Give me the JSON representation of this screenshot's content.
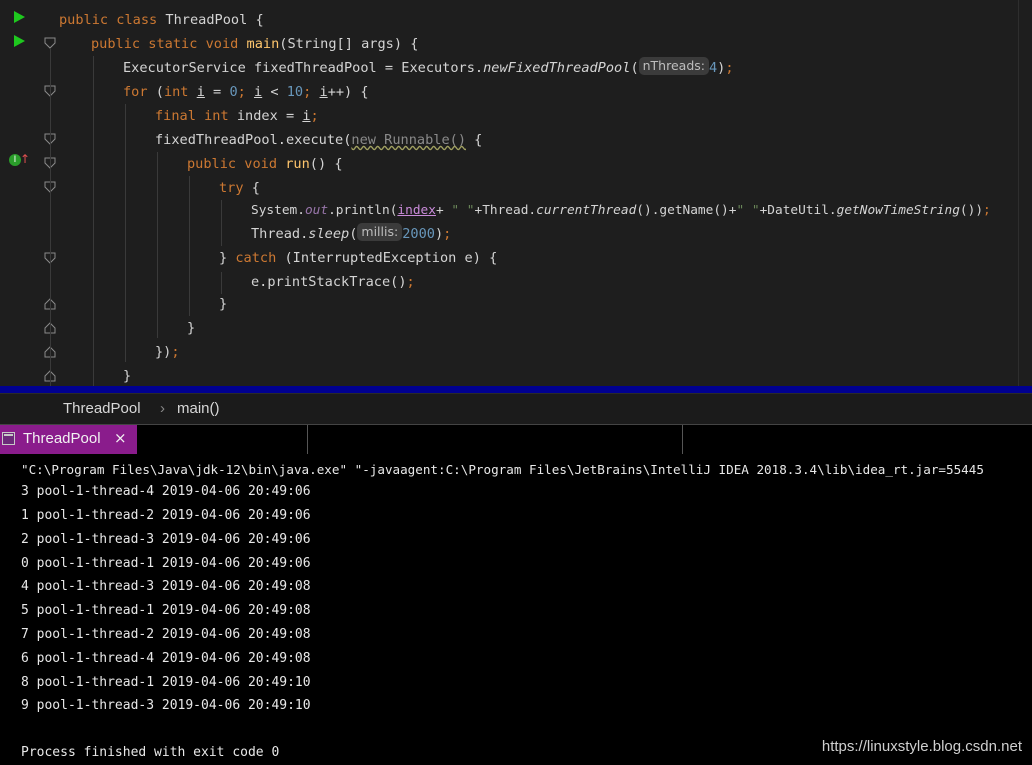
{
  "editor": {
    "l1": {
      "kw": "public class",
      "name": "ThreadPool",
      "brace": "{"
    },
    "l2": {
      "kw": "public static void",
      "fn": "main",
      "rest": "(String[] args) {"
    },
    "l3": {
      "pre": "ExecutorService fixedThreadPool = Executors.",
      "method": "newFixedThreadPool",
      "open": "(",
      "hint": "nThreads:",
      "num": "4",
      "close": ")",
      "semi": ";"
    },
    "l4": {
      "kw": "for",
      "open": " (",
      "kw2": "int",
      "var": "i",
      "eq": " = ",
      "zero": "0",
      "semi1": "; ",
      "var2": "i",
      "lt": " < ",
      "ten": "10",
      "semi2": "; ",
      "var3": "i",
      "inc": "++) {"
    },
    "l5": {
      "kw": "final int",
      "mid": " index = ",
      "var": "i",
      "semi": ";"
    },
    "l6": {
      "pre": "fixedThreadPool.execute(",
      "anon": "new Runnable()",
      "post": " {"
    },
    "l7": {
      "kw": "public void",
      "fn": "run",
      "rest": "() {"
    },
    "l8": {
      "kw": "try",
      "rest": " {"
    },
    "l9": {
      "a": "System.",
      "out": "out",
      "b": ".println(",
      "idx": "index",
      "c": "+ ",
      "s1": "\" \"",
      "d": "+Thread.",
      "ct": "currentThread",
      "e": "().getName()+",
      "s2": "\" \"",
      "f": "+DateUtil.",
      "gt": "getNowTimeString",
      "g": "())",
      "semi": ";"
    },
    "l10": {
      "a": "Thread.",
      "sleep": "sleep",
      "open": "(",
      "hint": "millis:",
      "num": "2000",
      "close": ")",
      "semi": ";"
    },
    "l11": {
      "a": "} ",
      "kw": "catch",
      "rest": " (InterruptedException e) {"
    },
    "l12": {
      "a": "e.printStackTrace()",
      "semi": ";"
    },
    "l13": {
      "a": "}"
    },
    "l14": {
      "a": "}"
    },
    "l15": {
      "a": "})",
      "semi": ";"
    },
    "l16": {
      "a": "}"
    },
    "gutter_badge": "I"
  },
  "breadcrumb": {
    "class_name": "ThreadPool",
    "sep": "›",
    "method": "main()"
  },
  "run_tab": {
    "label": "ThreadPool",
    "close": "×"
  },
  "console": {
    "command": "\"C:\\Program Files\\Java\\jdk-12\\bin\\java.exe\" \"-javaagent:C:\\Program Files\\JetBrains\\IntelliJ IDEA 2018.3.4\\lib\\idea_rt.jar=55445",
    "lines": [
      "3 pool-1-thread-4 2019-04-06 20:49:06",
      "1 pool-1-thread-2 2019-04-06 20:49:06",
      "2 pool-1-thread-3 2019-04-06 20:49:06",
      "0 pool-1-thread-1 2019-04-06 20:49:06",
      "4 pool-1-thread-3 2019-04-06 20:49:08",
      "5 pool-1-thread-1 2019-04-06 20:49:08",
      "7 pool-1-thread-2 2019-04-06 20:49:08",
      "6 pool-1-thread-4 2019-04-06 20:49:08",
      "8 pool-1-thread-1 2019-04-06 20:49:10",
      "9 pool-1-thread-3 2019-04-06 20:49:10"
    ],
    "exit": "Process finished with exit code 0"
  },
  "watermark": "https://linuxstyle.blog.csdn.net",
  "colors": {
    "run_tab": "#8a1c8c",
    "run_arrow": "#1ec81e",
    "separator": "#000090"
  }
}
